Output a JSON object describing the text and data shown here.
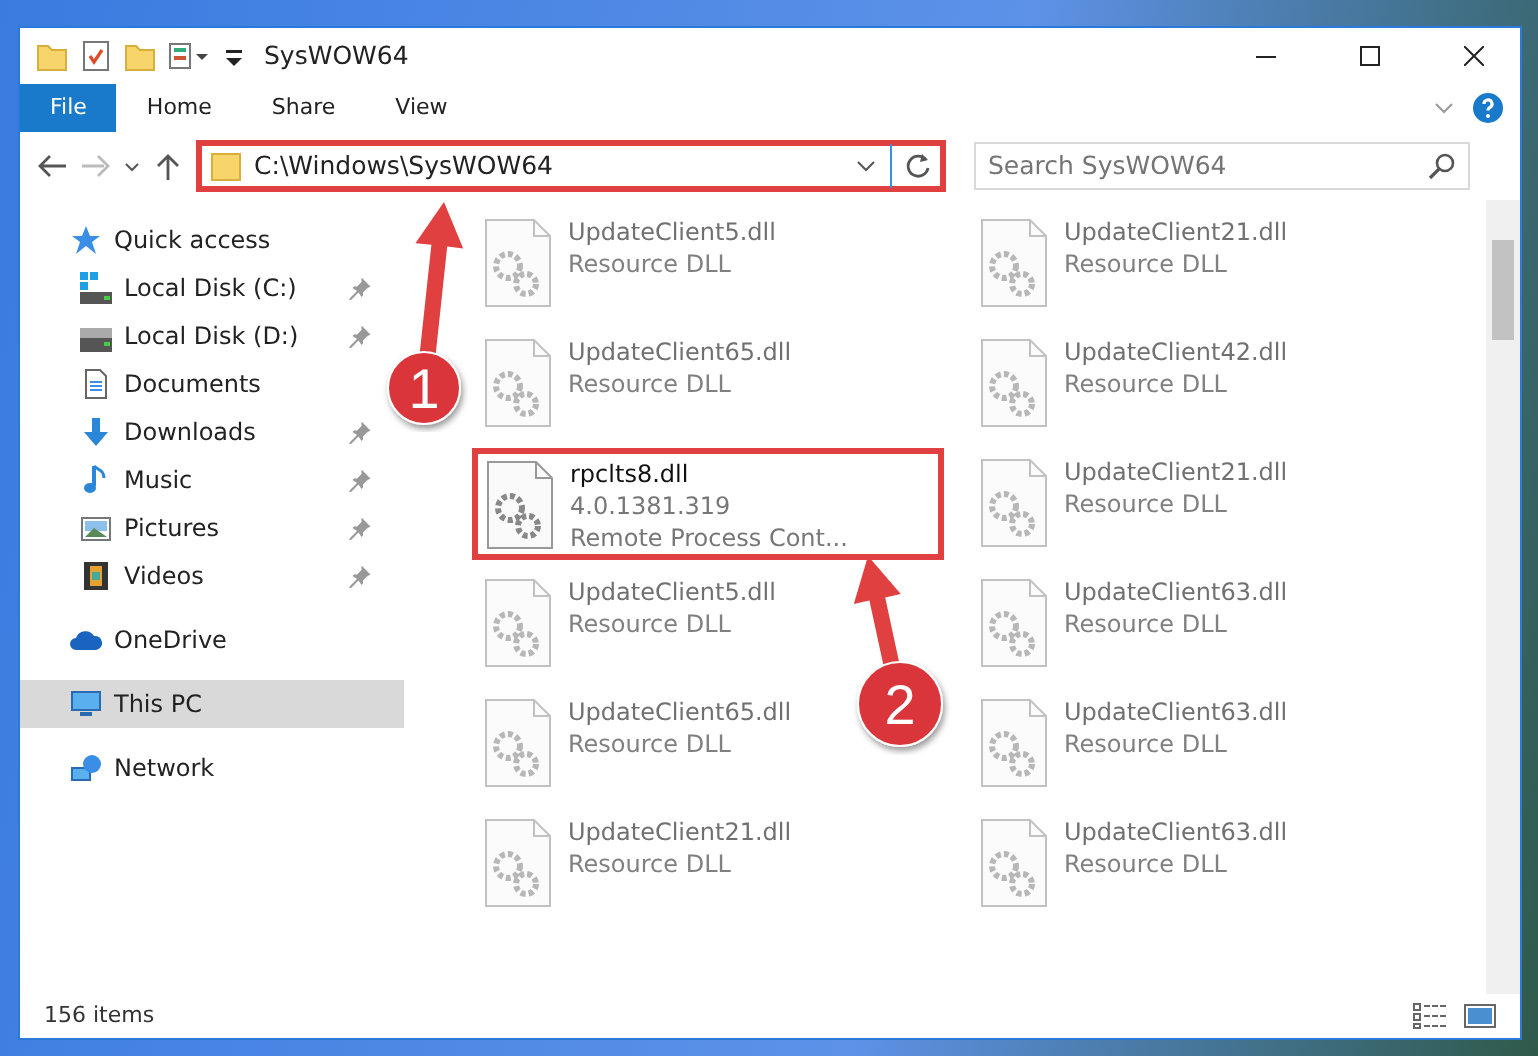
{
  "window": {
    "title": "SysWOW64"
  },
  "ribbon_tabs": [
    {
      "label": "File",
      "selected": true
    },
    {
      "label": "Home",
      "selected": false
    },
    {
      "label": "Share",
      "selected": false
    },
    {
      "label": "View",
      "selected": false
    }
  ],
  "address_bar": {
    "path": "C:\\Windows\\SysWOW64",
    "highlighted": true
  },
  "search": {
    "placeholder": "Search SysWOW64"
  },
  "sidebar": {
    "items": [
      {
        "label": "Quick access",
        "kind": "star",
        "selected": false,
        "children": [
          {
            "label": "Local Disk (C:)",
            "kind": "drive-win",
            "pinned": true
          },
          {
            "label": "Local Disk (D:)",
            "kind": "drive",
            "pinned": true
          },
          {
            "label": "Documents",
            "kind": "document"
          },
          {
            "label": "Downloads",
            "kind": "download",
            "pinned": true
          },
          {
            "label": "Music",
            "kind": "music",
            "pinned": true
          },
          {
            "label": "Pictures",
            "kind": "pictures",
            "pinned": true
          },
          {
            "label": "Videos",
            "kind": "videos",
            "pinned": true
          }
        ]
      },
      {
        "label": "OneDrive",
        "kind": "cloud",
        "selected": false
      },
      {
        "label": "This PC",
        "kind": "pc",
        "selected": true
      },
      {
        "label": "Network",
        "kind": "network",
        "selected": false
      }
    ]
  },
  "files": [
    {
      "name": "UpdateClient5.dll",
      "details": [
        "Resource DLL"
      ],
      "highlighted": false
    },
    {
      "name": "UpdateClient21.dll",
      "details": [
        "Resource DLL"
      ],
      "highlighted": false
    },
    {
      "name": "UpdateClient65.dll",
      "details": [
        "Resource DLL"
      ],
      "highlighted": false
    },
    {
      "name": "UpdateClient42.dll",
      "details": [
        "Resource DLL"
      ],
      "highlighted": false
    },
    {
      "name": "rpclts8.dll",
      "details": [
        "4.0.1381.319",
        "Remote Process Cont..."
      ],
      "highlighted": true
    },
    {
      "name": "UpdateClient21.dll",
      "details": [
        "Resource DLL"
      ],
      "highlighted": false
    },
    {
      "name": "UpdateClient5.dll",
      "details": [
        "Resource DLL"
      ],
      "highlighted": false
    },
    {
      "name": "UpdateClient63.dll",
      "details": [
        "Resource DLL"
      ],
      "highlighted": false
    },
    {
      "name": "UpdateClient65.dll",
      "details": [
        "Resource DLL"
      ],
      "highlighted": false
    },
    {
      "name": "UpdateClient63.dll",
      "details": [
        "Resource DLL"
      ],
      "highlighted": false
    },
    {
      "name": "UpdateClient21.dll",
      "details": [
        "Resource DLL"
      ],
      "highlighted": false
    },
    {
      "name": "UpdateClient63.dll",
      "details": [
        "Resource DLL"
      ],
      "highlighted": false
    }
  ],
  "status_bar": {
    "item_count": "156 items"
  },
  "callouts": [
    {
      "number": "1"
    },
    {
      "number": "2"
    }
  ]
}
